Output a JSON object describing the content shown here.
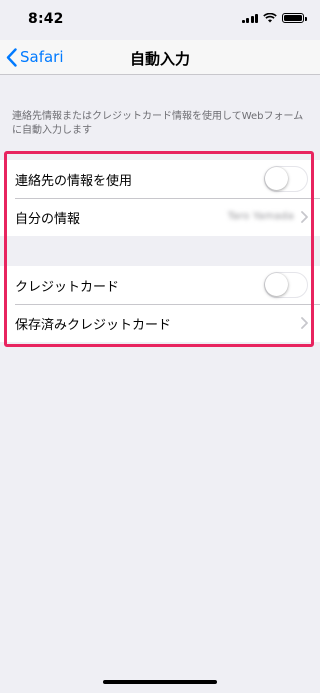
{
  "status_bar": {
    "time": "8:42"
  },
  "nav": {
    "back_label": "Safari",
    "title": "自動入力"
  },
  "description": "連絡先情報またはクレジットカード情報を使用してWebフォームに自動入力します",
  "contact_group": {
    "use_contact_info_label": "連絡先の情報を使用",
    "use_contact_info_on": false,
    "my_info_label": "自分の情報",
    "my_info_value": "Taro Yamada"
  },
  "card_group": {
    "credit_cards_label": "クレジットカード",
    "credit_cards_on": false,
    "saved_cards_label": "保存済みクレジットカード"
  },
  "colors": {
    "accent": "#007aff",
    "highlight": "#e8245f",
    "background": "#efeff4"
  }
}
